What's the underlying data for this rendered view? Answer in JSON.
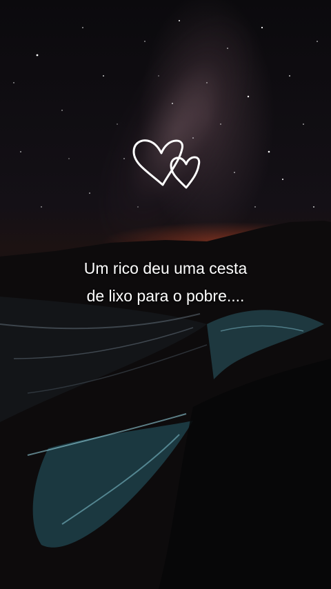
{
  "caption": {
    "line1": "Um rico deu uma cesta",
    "line2": "de lixo para o pobre...."
  },
  "decoration": {
    "icon": "two-hearts-icon",
    "heart_color": "#ffffff"
  },
  "colors": {
    "horizon_glow": "#c2462a",
    "water_glow": "#7fd6e6"
  }
}
